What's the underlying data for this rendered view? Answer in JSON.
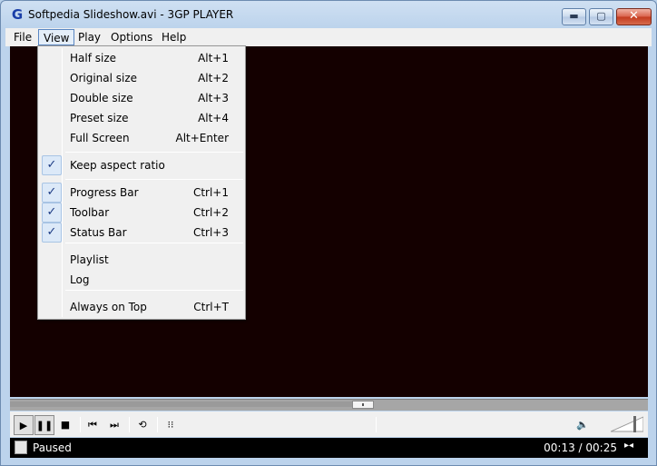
{
  "window": {
    "title": "Softpedia Slideshow.avi - 3GP PLAYER",
    "app_icon": "G",
    "controls": {
      "minimize": "minimize-icon",
      "maximize": "maximize-icon",
      "close": "close-icon"
    }
  },
  "menubar": {
    "items": [
      {
        "label": "File"
      },
      {
        "label": "View"
      },
      {
        "label": "Play"
      },
      {
        "label": "Options"
      },
      {
        "label": "Help"
      }
    ],
    "active": "View"
  },
  "view_menu": {
    "items": [
      {
        "label": "Half size",
        "shortcut": "Alt+1",
        "checked": false
      },
      {
        "label": "Original size",
        "shortcut": "Alt+2",
        "checked": false
      },
      {
        "label": "Double size",
        "shortcut": "Alt+3",
        "checked": false
      },
      {
        "label": "Preset size",
        "shortcut": "Alt+4",
        "checked": false
      },
      {
        "label": "Full Screen",
        "shortcut": "Alt+Enter",
        "checked": false
      },
      {
        "label": "Keep aspect ratio",
        "shortcut": "",
        "checked": true
      },
      {
        "label": "Progress Bar",
        "shortcut": "Ctrl+1",
        "checked": true
      },
      {
        "label": "Toolbar",
        "shortcut": "Ctrl+2",
        "checked": true
      },
      {
        "label": "Status Bar",
        "shortcut": "Ctrl+3",
        "checked": true
      },
      {
        "label": "Playlist",
        "shortcut": "",
        "checked": false
      },
      {
        "label": "Log",
        "shortcut": "",
        "checked": false
      },
      {
        "label": "Always on Top",
        "shortcut": "Ctrl+T",
        "checked": false
      }
    ],
    "check_glyph": "✓"
  },
  "progress": {
    "fraction": 0.555
  },
  "toolbar": {
    "buttons": [
      {
        "icon": "play-icon",
        "glyph": "▶",
        "pressed": true
      },
      {
        "icon": "pause-icon",
        "glyph": "❚❚",
        "pressed": true
      },
      {
        "icon": "stop-icon",
        "glyph": "■",
        "pressed": false
      },
      {
        "icon": "previous-icon",
        "glyph": "⏮",
        "pressed": false
      },
      {
        "icon": "next-icon",
        "glyph": "⏭",
        "pressed": false
      },
      {
        "icon": "repeat-icon",
        "glyph": "⟲",
        "pressed": false
      },
      {
        "icon": "playlist-icon",
        "glyph": "⁝⁝",
        "pressed": false
      }
    ],
    "volume_icon": "🔈",
    "volume_level": 0.75
  },
  "statusbar": {
    "status": "Paused",
    "time": "00:13 / 00:25",
    "mini_icon": "▸◂"
  },
  "colors": {
    "video_bg": "#140000",
    "accent": "#5a87c3"
  }
}
